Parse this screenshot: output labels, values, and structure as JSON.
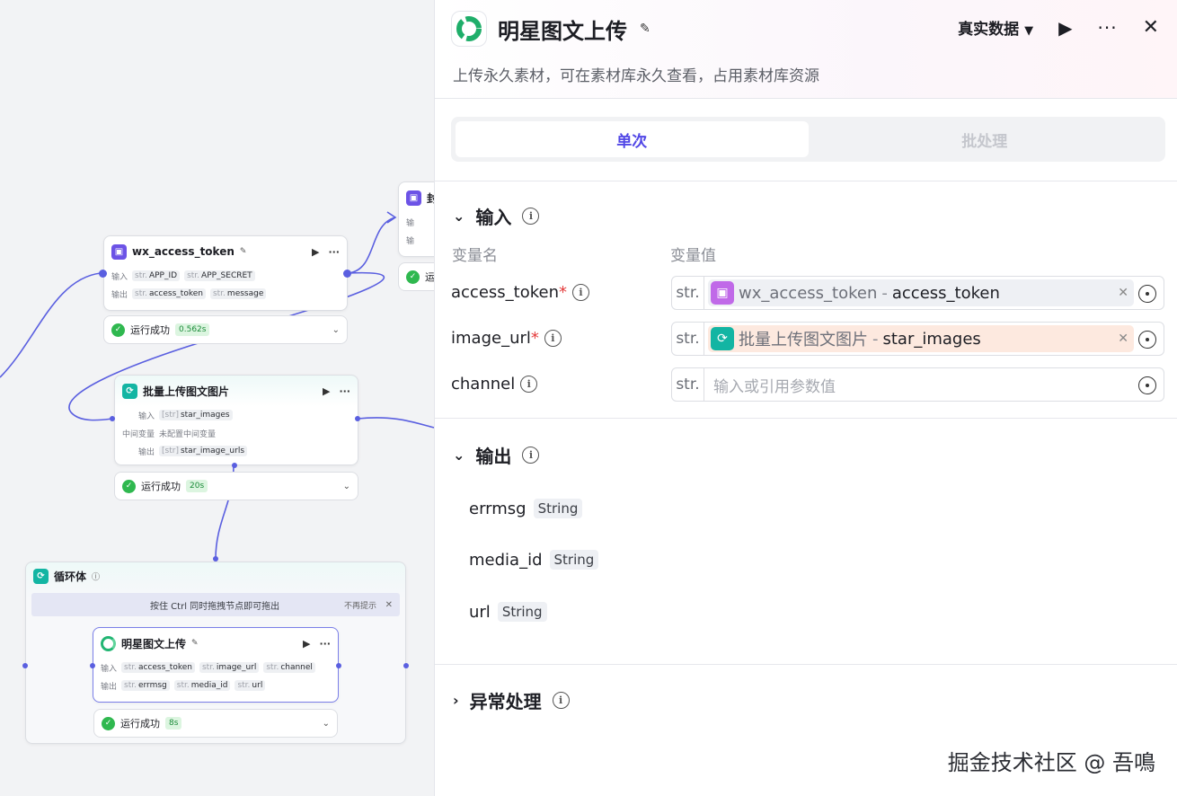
{
  "canvas": {
    "node_token": {
      "title": "wx_access_token",
      "in_label": "输入",
      "out_label": "输出",
      "inputs": [
        "APP_ID",
        "APP_SECRET"
      ],
      "outputs": [
        "access_token",
        "message"
      ]
    },
    "status_token": {
      "label": "运行成功",
      "duration": "0.562s"
    },
    "node_partial": {
      "title": "封",
      "in_label": "输",
      "out_label": "输",
      "status": "运"
    },
    "node_batch": {
      "title": "批量上传图文图片",
      "in_label": "输入",
      "mid_label": "中间变量",
      "mid_value": "未配置中间变量",
      "out_label": "输出",
      "input": "star_images",
      "output": "star_image_urls",
      "list_prefix": "[str]"
    },
    "status_batch": {
      "label": "运行成功",
      "duration": "20s"
    },
    "loop": {
      "title": "循环体",
      "hint": "按住 Ctrl 同时拖拽节点即可拖出",
      "dismiss": "不再提示"
    },
    "node_star": {
      "title": "明星图文上传",
      "in_label": "输入",
      "out_label": "输出",
      "inputs": [
        "access_token",
        "image_url",
        "channel"
      ],
      "outputs": [
        "errmsg",
        "media_id",
        "url"
      ]
    },
    "status_star": {
      "label": "运行成功",
      "duration": "8s"
    },
    "str_prefix": "str."
  },
  "panel": {
    "title": "明星图文上传",
    "description": "上传永久素材，可在素材库永久查看，占用素材库资源",
    "data_select": "真实数据",
    "tabs": [
      "单次",
      "批处理"
    ],
    "input_section": "输入",
    "col_name": "变量名",
    "col_value": "变量值",
    "fields": [
      {
        "name": "access_token",
        "required": "*",
        "type": "str.",
        "source": "wx_access_token",
        "sep": "-",
        "ref": "access_token"
      },
      {
        "name": "image_url",
        "required": "*",
        "type": "str.",
        "source": "批量上传图文图片",
        "sep": "-",
        "ref": "star_images"
      },
      {
        "name": "channel",
        "type": "str.",
        "placeholder": "输入或引用参数值"
      }
    ],
    "output_section": "输出",
    "outputs": [
      {
        "name": "errmsg",
        "type": "String"
      },
      {
        "name": "media_id",
        "type": "String"
      },
      {
        "name": "url",
        "type": "String"
      }
    ],
    "exception_section": "异常处理",
    "watermark": "掘金技术社区 @ 吾鳴"
  },
  "colors": {
    "accent": "#5147e6",
    "success": "#2fb84f",
    "required": "#e43b3b",
    "plugin": "#6c53e6",
    "loop": "#13b5a3"
  }
}
